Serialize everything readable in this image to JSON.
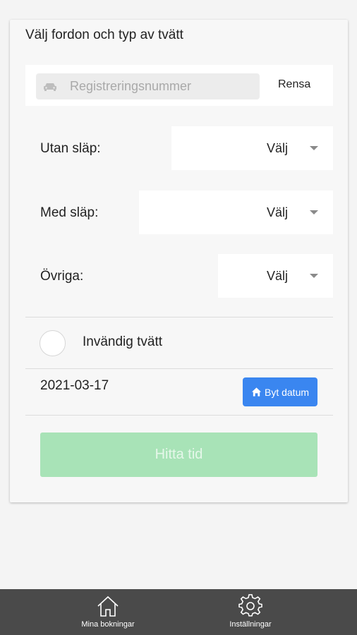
{
  "form": {
    "title": "Välj fordon och typ av tvätt",
    "registration": {
      "placeholder": "Registreringsnummer",
      "value": "",
      "clear_label": "Rensa"
    },
    "selects": [
      {
        "label": "Utan släp:",
        "value": "Välj"
      },
      {
        "label": "Med släp:",
        "value": "Välj"
      },
      {
        "label": "Övriga:",
        "value": "Välj"
      }
    ],
    "interior_wash_label": "Invändig tvätt",
    "interior_wash_checked": false,
    "date": "2021-03-17",
    "change_date_label": "Byt datum",
    "find_time_label": "Hitta tid"
  },
  "tabbar": {
    "items": [
      {
        "label": "Mina bokningar",
        "icon": "home-icon"
      },
      {
        "label": "Inställningar",
        "icon": "gear-icon"
      }
    ]
  },
  "colors": {
    "primary_button": "#3a86f0",
    "find_button_disabled": "#a8e3b7",
    "tabbar": "#4a4a4a"
  }
}
